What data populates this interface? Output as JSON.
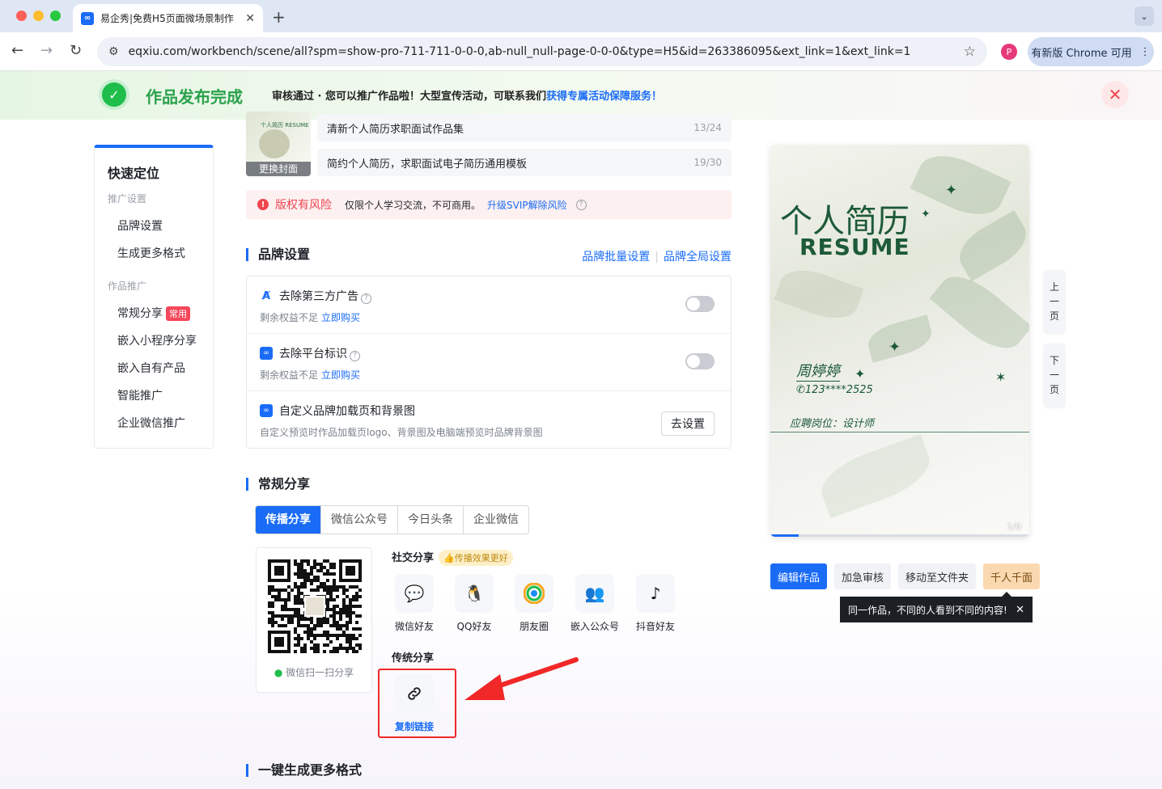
{
  "browser": {
    "tab_title": "易企秀|免费H5页面微场景制作",
    "url": "eqxiu.com/workbench/scene/all?spm=show-pro-711-711-0-0-0,ab-null_null-page-0-0-0&type=H5&id=263386095&ext_link=1&ext_link=1",
    "profile_initial": "P",
    "update_label": "有新版 Chrome 可用"
  },
  "banner": {
    "title": "作品发布完成",
    "message": "审核通过 · 您可以推广作品啦！大型宣传活动，可联系我们",
    "link": "获得专属活动保障服务！"
  },
  "quick_nav": {
    "title": "快速定位",
    "section1": "推广设置",
    "items1": [
      "品牌设置",
      "生成更多格式"
    ],
    "section2": "作品推广",
    "items2": [
      "常规分享",
      "嵌入小程序分享",
      "嵌入自有产品",
      "智能推广",
      "企业微信推广"
    ],
    "hot_badge": "常用"
  },
  "work": {
    "cover_label": "更换封面",
    "cover_title": "个人简历 RESUME",
    "title_value": "清新个人简历求职面试作品集",
    "title_count": "13/24",
    "desc_value": "简约个人简历，求职面试电子简历通用模板",
    "desc_count": "19/30"
  },
  "risk": {
    "label": "版权有风险",
    "text": "仅限个人学习交流，不可商用。",
    "link": "升级SVIP解除风险"
  },
  "brand": {
    "section_title": "品牌设置",
    "batch_link": "品牌批量设置",
    "global_link": "品牌全局设置",
    "rows": [
      {
        "title": "去除第三方广告",
        "sub": "剩余权益不足",
        "link": "立即购买"
      },
      {
        "title": "去除平台标识",
        "sub": "剩余权益不足",
        "link": "立即购买"
      },
      {
        "title": "自定义品牌加载页和背景图",
        "sub": "自定义预览时作品加载页logo、背景图及电脑端预览时品牌背景图",
        "button": "去设置"
      }
    ]
  },
  "share": {
    "section_title": "常规分享",
    "tabs": [
      "传播分享",
      "微信公众号",
      "今日头条",
      "企业微信"
    ],
    "qr_caption": "微信扫一扫分享",
    "social_title": "社交分享",
    "social_badge": "👍传播效果更好",
    "social": [
      "微信好友",
      "QQ好友",
      "朋友圈",
      "嵌入公众号",
      "抖音好友"
    ],
    "traditional_title": "传统分享",
    "copy_link": "复制链接"
  },
  "more_formats": {
    "section_title": "一键生成更多格式"
  },
  "preview": {
    "title_cn": "个人简历",
    "title_en": "RESUME",
    "name": "周婷婷",
    "phone": "123****2525",
    "role": "应聘岗位：设计师",
    "page_indicator": "1/9",
    "progress": 0.11,
    "prev_page": "上\n一\n页",
    "next_page": "下\n一\n页"
  },
  "actions": {
    "edit": "编辑作品",
    "urgent": "加急审核",
    "move": "移动至文件夹",
    "thousand": "千人千面",
    "tooltip": "同一作品，不同的人看到不同的内容!"
  },
  "colors": {
    "accent": "#1a6cf6",
    "success": "#1fbd4a",
    "danger": "#f0454f",
    "annotation": "#f02828"
  }
}
